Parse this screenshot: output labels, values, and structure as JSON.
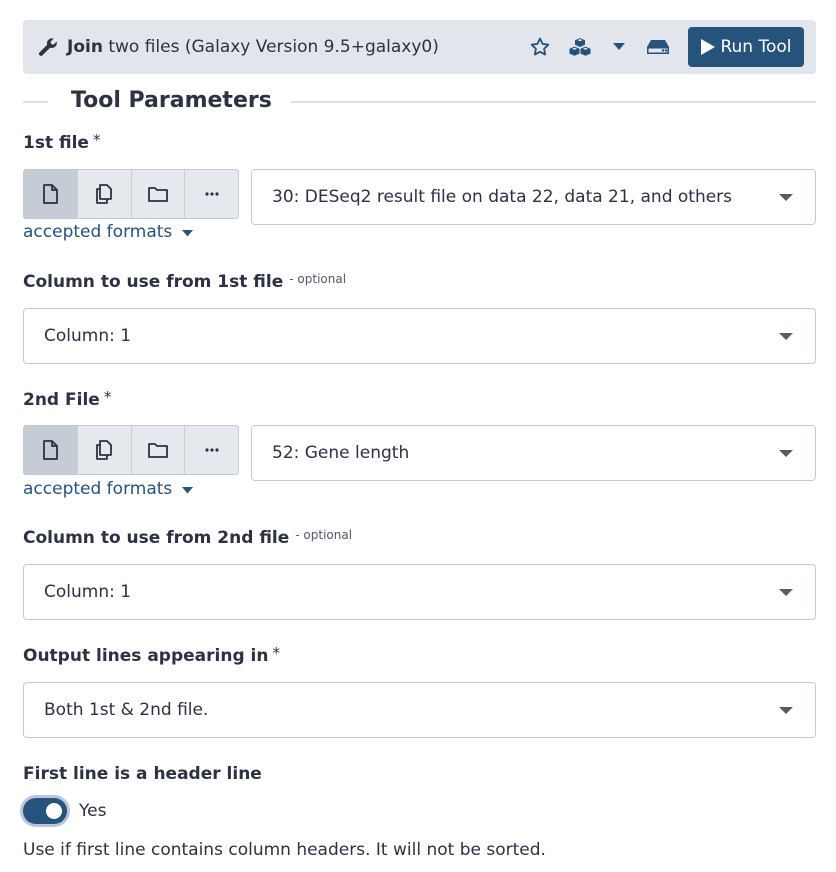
{
  "header": {
    "tool_name": "Join",
    "tool_desc": "two files (Galaxy Version 9.5+galaxy0)",
    "run_label": "Run Tool"
  },
  "section": {
    "title": "Tool Parameters"
  },
  "file1": {
    "label": "1st file",
    "required": "*",
    "selected": "30: DESeq2 result file on data 22, data 21, and others",
    "accepted": "accepted formats"
  },
  "col1": {
    "label": "Column to use from 1st file",
    "optional": "- optional",
    "value": "Column: 1"
  },
  "file2": {
    "label": "2nd File",
    "required": "*",
    "selected": "52: Gene length",
    "accepted": "accepted formats"
  },
  "col2": {
    "label": "Column to use from 2nd file",
    "optional": "- optional",
    "value": "Column: 1"
  },
  "output": {
    "label": "Output lines appearing in",
    "required": "*",
    "value": "Both 1st & 2nd file."
  },
  "header_line": {
    "label": "First line is a header line",
    "toggle_label": "Yes",
    "toggle_on": true,
    "help": "Use if first line contains column headers. It will not be sorted."
  },
  "colors": {
    "accent": "#25537b",
    "header_bg": "#e2e5eb",
    "text": "#2c3143"
  },
  "icons": {
    "header": [
      "wrench-icon",
      "star-icon",
      "cubes-icon",
      "caret-down-icon",
      "hdd-icon",
      "play-icon"
    ],
    "file_buttons": [
      "file-icon",
      "copy-icon",
      "folder-icon",
      "ellipsis-icon"
    ]
  }
}
